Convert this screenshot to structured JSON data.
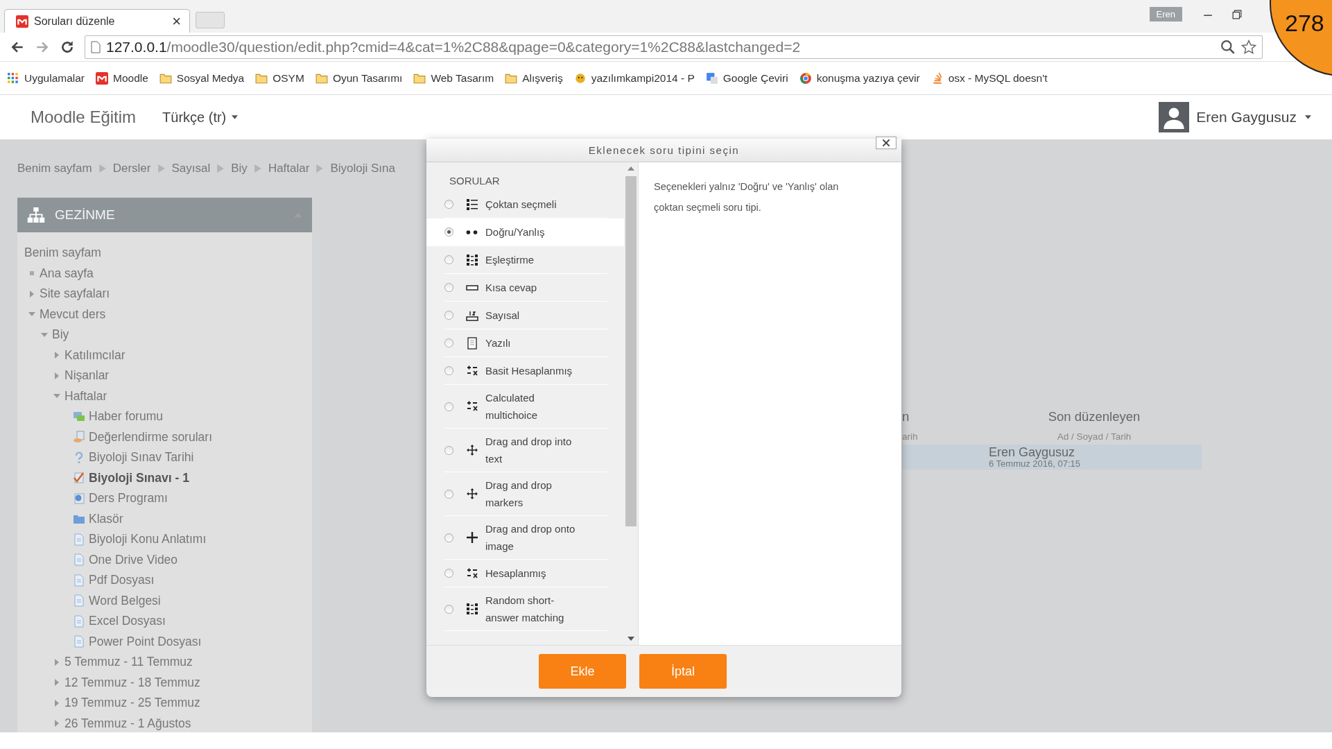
{
  "browser": {
    "tab": {
      "title": "Soruları düzenle",
      "close": "×"
    },
    "profile": "Eren",
    "url_host": "127.0.0.1",
    "url_path": "/moodle30/question/edit.php?cmid=4&cat=1%2C88&qpage=0&category=1%2C88&lastchanged=2",
    "bookmarks": [
      {
        "label": "Uygulamalar",
        "kind": "apps"
      },
      {
        "label": "Moodle",
        "kind": "moodle"
      },
      {
        "label": "Sosyal Medya",
        "kind": "folder"
      },
      {
        "label": "OSYM",
        "kind": "folder"
      },
      {
        "label": "Oyun Tasarımı",
        "kind": "folder"
      },
      {
        "label": "Web Tasarım",
        "kind": "folder"
      },
      {
        "label": "Alışveriş",
        "kind": "folder"
      },
      {
        "label": "yazılımkampi2014 - P",
        "kind": "site"
      },
      {
        "label": "Google Çeviri",
        "kind": "translate"
      },
      {
        "label": "konuşma yazıya çevir",
        "kind": "globe"
      },
      {
        "label": "osx - MySQL doesn't",
        "kind": "stack"
      }
    ]
  },
  "badge": "278",
  "navbar": {
    "brand": "Moodle Eğitim",
    "language": "Türkçe (tr)",
    "user": "Eren Gaygusuz"
  },
  "breadcrumbs": [
    "Benim sayfam",
    "Dersler",
    "Sayısal",
    "Biy",
    "Haftalar",
    "Biyoloji Sına"
  ],
  "navigation": {
    "title": "GEZİNME",
    "tree": [
      {
        "label": "Benim sayfam",
        "children": [
          {
            "label": "Ana sayfa",
            "kind": "bullet"
          },
          {
            "label": "Site sayfaları",
            "kind": "branch",
            "expanded": false
          },
          {
            "label": "Mevcut ders",
            "kind": "branch",
            "expanded": true,
            "children": [
              {
                "label": "Biy",
                "kind": "branch",
                "expanded": true,
                "children": [
                  {
                    "label": "Katılımcılar",
                    "kind": "branch",
                    "expanded": false
                  },
                  {
                    "label": "Nişanlar",
                    "kind": "branch",
                    "expanded": false
                  },
                  {
                    "label": "Haftalar",
                    "kind": "branch",
                    "expanded": true,
                    "children": [
                      {
                        "label": "Haber forumu",
                        "kind": "forum",
                        "current": false
                      },
                      {
                        "label": "Değerlendirme soruları",
                        "kind": "feedback",
                        "current": false
                      },
                      {
                        "label": "Biyoloji Sınav Tarihi",
                        "kind": "question",
                        "current": false
                      },
                      {
                        "label": "Biyoloji Sınavı - 1",
                        "kind": "quiz",
                        "current": true
                      },
                      {
                        "label": "Ders Programı",
                        "kind": "url",
                        "current": false
                      },
                      {
                        "label": "Klasör",
                        "kind": "folder",
                        "current": false
                      },
                      {
                        "label": "Biyoloji Konu Anlatımı",
                        "kind": "file",
                        "current": false
                      },
                      {
                        "label": "One Drive Video",
                        "kind": "file",
                        "current": false
                      },
                      {
                        "label": "Pdf Dosyası",
                        "kind": "file",
                        "current": false
                      },
                      {
                        "label": "Word Belgesi",
                        "kind": "file",
                        "current": false
                      },
                      {
                        "label": "Excel Dosyası",
                        "kind": "file",
                        "current": false
                      },
                      {
                        "label": "Power Point Dosyası",
                        "kind": "file",
                        "current": false
                      }
                    ]
                  },
                  {
                    "label": "5 Temmuz - 11 Temmuz",
                    "kind": "branch",
                    "expanded": false
                  },
                  {
                    "label": "12 Temmuz - 18 Temmuz",
                    "kind": "branch",
                    "expanded": false
                  },
                  {
                    "label": "19 Temmuz - 25 Temmuz",
                    "kind": "branch",
                    "expanded": false
                  },
                  {
                    "label": "26 Temmuz - 1 Ağustos",
                    "kind": "branch",
                    "expanded": false
                  }
                ]
              }
            ]
          }
        ]
      }
    ]
  },
  "background_table": {
    "columns": [
      {
        "heading": "n",
        "subheading": "arih"
      },
      {
        "heading": "Son düzenleyen",
        "subheading": "Ad / Soyad / Tarih"
      }
    ],
    "row": {
      "name": "Eren Gaygusuz",
      "date": "6 Temmuz 2016, 07:15"
    }
  },
  "dialog": {
    "title": "Eklenecek soru tipini seçin",
    "section": "SORULAR",
    "types": [
      {
        "label": "Çoktan seçmeli",
        "kind": "multichoice",
        "selected": false
      },
      {
        "label": "Doğru/Yanlış",
        "kind": "truefalse",
        "selected": true
      },
      {
        "label": "Eşleştirme",
        "kind": "match",
        "selected": false
      },
      {
        "label": "Kısa cevap",
        "kind": "shortanswer",
        "selected": false
      },
      {
        "label": "Sayısal",
        "kind": "numerical",
        "selected": false
      },
      {
        "label": "Yazılı",
        "kind": "essay",
        "selected": false
      },
      {
        "label": "Basit Hesaplanmış",
        "kind": "calculated",
        "selected": false
      },
      {
        "label": "Calculated multichoice",
        "kind": "calculated",
        "selected": false
      },
      {
        "label": "Drag and drop into text",
        "kind": "move",
        "selected": false
      },
      {
        "label": "Drag and drop markers",
        "kind": "move",
        "selected": false
      },
      {
        "label": "Drag and drop onto image",
        "kind": "plus",
        "selected": false
      },
      {
        "label": "Hesaplanmış",
        "kind": "calculated",
        "selected": false
      },
      {
        "label": "Random short-answer matching",
        "kind": "match",
        "selected": false
      }
    ],
    "description": "Seçenekleri yalnız 'Doğru' ve 'Yanlış' olan çoktan seçmeli soru tipi.",
    "buttons": [
      "Ekle",
      "İptal"
    ]
  }
}
